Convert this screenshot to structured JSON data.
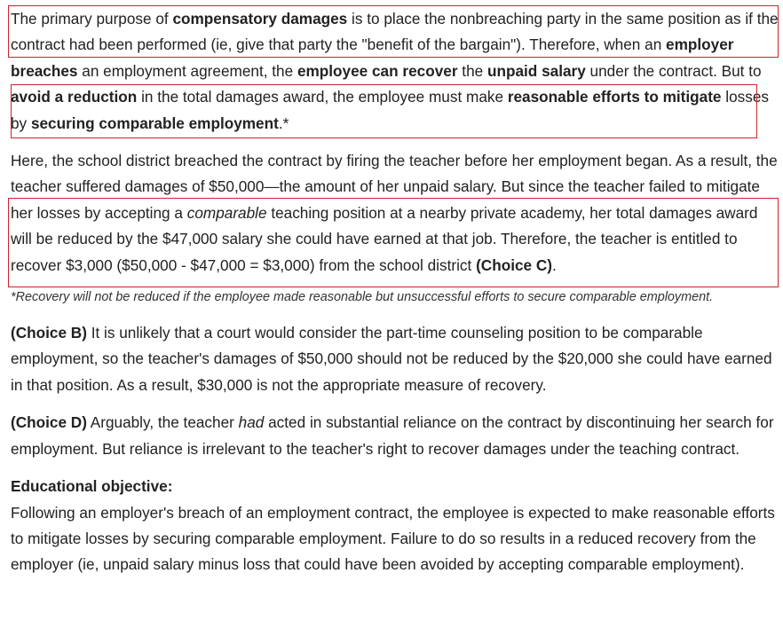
{
  "colors": {
    "text": "#222222",
    "highlight_box": "#d0202e"
  },
  "para1": {
    "s1": "The primary purpose of ",
    "b1": "compensatory damages",
    "s2": " is to place the nonbreaching party in the same position as if the contract had been performed (ie, give that party the \"benefit of the bargain\").  Therefore, when an ",
    "b2": "employer breaches",
    "s3": " an employment agreement, the ",
    "b3": "employee can recover",
    "s4": " the ",
    "b4": "unpaid salary",
    "s5": " under the contract.  But to ",
    "b5": "avoid a reduction",
    "s6": " in the total damages award, the employee must make ",
    "b6": "reasonable efforts to mitigate",
    "s7": " losses by ",
    "b7": "securing comparable employment",
    "s8": ".*"
  },
  "para2": {
    "s1": "Here, the school district breached the contract by firing the teacher before her employment began.  As a result, the teacher suffered damages of $50,000—the amount of her unpaid salary.  But since the teacher failed to mitigate her losses by accepting a ",
    "i1": "comparable",
    "s2": " teaching position at a nearby private academy, her total damages award will be reduced by the $47,000 salary she could have earned at that job.  Therefore, the teacher is entitled to recover $3,000 ($50,000 - $47,000 = $3,000) from the school district ",
    "b1": "(Choice C)",
    "s3": "."
  },
  "footnote": "*Recovery will not be reduced if the employee made reasonable but unsuccessful efforts to secure comparable employment.",
  "choice_b": {
    "label": "(Choice B)",
    "text": "  It is unlikely that a court would consider the part-time counseling position to be comparable employment, so the teacher's damages of $50,000 should not be reduced by the $20,000 she could have earned in that position.  As a result, $30,000 is not the appropriate measure of recovery."
  },
  "choice_d": {
    "label": "(Choice D)",
    "s1": "  Arguably, the teacher ",
    "i1": "had",
    "s2": " acted in substantial reliance on the contract by discontinuing her search for employment.  But reliance is irrelevant to the teacher's right to recover damages under the teaching contract."
  },
  "objective": {
    "title": "Educational objective:",
    "text": "Following an employer's breach of an employment contract, the employee is expected to make reasonable efforts to mitigate losses by securing comparable employment.  Failure to do so results in a reduced recovery from the employer (ie, unpaid salary minus loss that could have been avoided by accepting comparable employment)."
  }
}
